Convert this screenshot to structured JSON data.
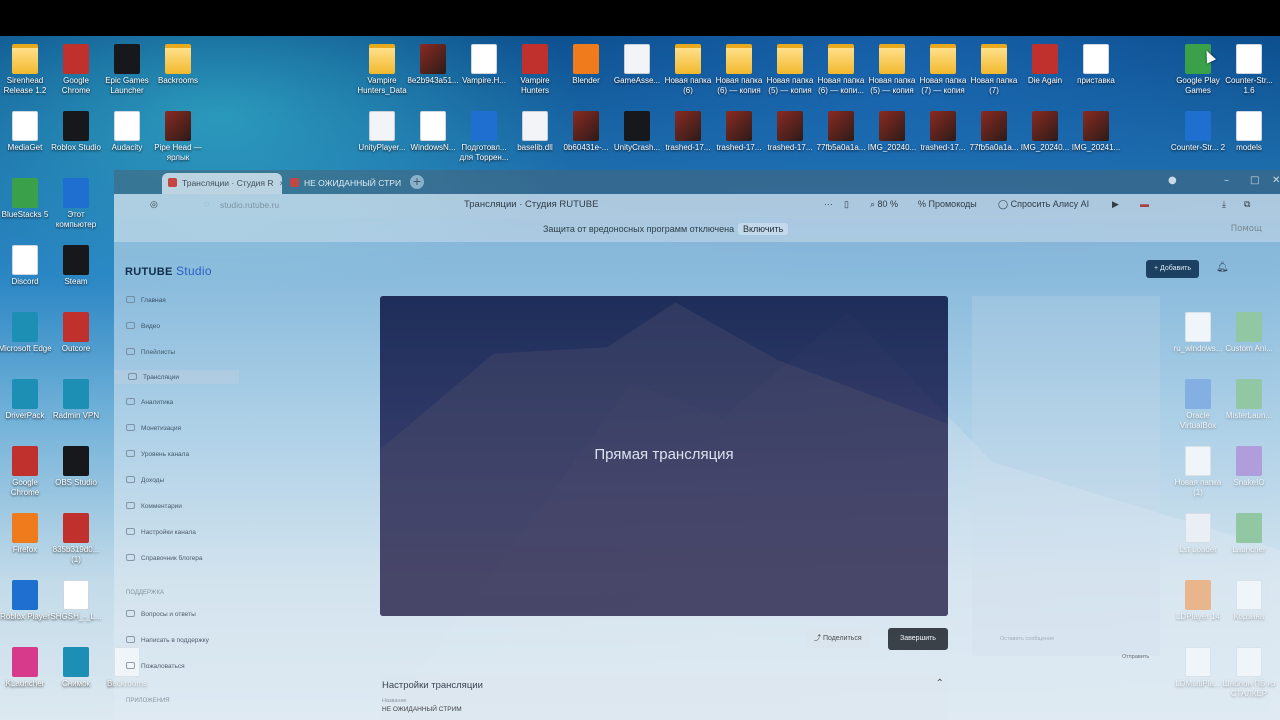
{
  "desktop": {
    "icons": [
      {
        "label": "Sirenhead Release 1.2",
        "kind": "folder"
      },
      {
        "label": "Google Chrome",
        "kind": "chrome"
      },
      {
        "label": "Epic Games Launcher",
        "kind": "epic"
      },
      {
        "label": "Backrooms",
        "kind": "folder"
      },
      {
        "label": "Vampire Hunters_Data",
        "kind": "folder"
      },
      {
        "label": "8e2b943a51...",
        "kind": "photo"
      },
      {
        "label": "Vampire.H...",
        "kind": "doc"
      },
      {
        "label": "Vampire Hunters",
        "kind": "game"
      },
      {
        "label": "Blender",
        "kind": "blender"
      },
      {
        "label": "GameAsse...",
        "kind": "cog"
      },
      {
        "label": "Новая папка (6)",
        "kind": "folder"
      },
      {
        "label": "Новая папка (6) — копия",
        "kind": "folder"
      },
      {
        "label": "Новая папка (5) — копия",
        "kind": "folder"
      },
      {
        "label": "Новая папка (6) — копи...",
        "kind": "folder"
      },
      {
        "label": "Новая папка (5) — копия",
        "kind": "folder"
      },
      {
        "label": "Новая папка (7) — копия",
        "kind": "folder"
      },
      {
        "label": "Новая папка (7)",
        "kind": "folder"
      },
      {
        "label": "Die Again",
        "kind": "game"
      },
      {
        "label": "приставка",
        "kind": "doc"
      },
      {
        "label": "Google Play Games",
        "kind": "gplay"
      },
      {
        "label": "Counter-Str... 1.6",
        "kind": "doc"
      },
      {
        "label": "MediaGet",
        "kind": "doc"
      },
      {
        "label": "Roblox Studio",
        "kind": "roblox"
      },
      {
        "label": "Audacity",
        "kind": "doc"
      },
      {
        "label": "Pipe Head — ярлык",
        "kind": "photo"
      },
      {
        "label": "UnityPlayer...",
        "kind": "cog"
      },
      {
        "label": "WindowsN...",
        "kind": "doc"
      },
      {
        "label": "Подготовл... для Торрен...",
        "kind": "globe"
      },
      {
        "label": "baselib.dll",
        "kind": "cog"
      },
      {
        "label": "0b60431e-...",
        "kind": "photo"
      },
      {
        "label": "UnityCrash...",
        "kind": "unity"
      },
      {
        "label": "trashed-17...",
        "kind": "photo"
      },
      {
        "label": "trashed-17...",
        "kind": "photo"
      },
      {
        "label": "trashed-17...",
        "kind": "photo"
      },
      {
        "label": "77fb5a0a1a...",
        "kind": "photo"
      },
      {
        "label": "IMG_20240...",
        "kind": "photo"
      },
      {
        "label": "trashed-17...",
        "kind": "photo"
      },
      {
        "label": "77fb5a0a1a...",
        "kind": "photo"
      },
      {
        "label": "IMG_20240...",
        "kind": "photo"
      },
      {
        "label": "IMG_20241...",
        "kind": "photo"
      },
      {
        "label": "Counter-Str... 2",
        "kind": "cs"
      },
      {
        "label": "models",
        "kind": "doc"
      },
      {
        "label": "BlueStacks 5",
        "kind": "bluestacks"
      },
      {
        "label": "Этот компьютер",
        "kind": "pc"
      },
      {
        "label": "Discord",
        "kind": "doc"
      },
      {
        "label": "Steam",
        "kind": "steam"
      },
      {
        "label": "Microsoft Edge",
        "kind": "edge"
      },
      {
        "label": "Outcore",
        "kind": "game"
      },
      {
        "label": "DriverPack",
        "kind": "teal"
      },
      {
        "label": "Radmin VPN",
        "kind": "radmin"
      },
      {
        "label": "Google Chrome",
        "kind": "chrome"
      },
      {
        "label": "OBS Studio",
        "kind": "obs"
      },
      {
        "label": "Firefox",
        "kind": "firefox"
      },
      {
        "label": "835b319d0... (1)",
        "kind": "game"
      },
      {
        "label": "Roblox Player",
        "kind": "roblox-player"
      },
      {
        "label": "SHGSH_-_L...",
        "kind": "doc"
      },
      {
        "label": "KLauncher",
        "kind": "klauncher"
      },
      {
        "label": "Снимок",
        "kind": "teal"
      },
      {
        "label": "Backrooms",
        "kind": "doc"
      },
      {
        "label": "LDMultiPla...",
        "kind": "doc"
      },
      {
        "label": "Шаблон ПБ из СТАЛКЕР",
        "kind": "pdf"
      },
      {
        "label": "LDPlayer 14",
        "kind": "ldplayer"
      },
      {
        "label": "Корзина",
        "kind": "bin"
      },
      {
        "label": "Lst Loader",
        "kind": "cog"
      },
      {
        "label": "Launcher",
        "kind": "green"
      },
      {
        "label": "Новая папка (1)",
        "kind": "doc"
      },
      {
        "label": "SnakeIO",
        "kind": "snake"
      },
      {
        "label": "Oracle VirtualBox",
        "kind": "vbox"
      },
      {
        "label": "MisterLaun...",
        "kind": "green"
      },
      {
        "label": "ru_windows...",
        "kind": "doc"
      },
      {
        "label": "Custom Ani...",
        "kind": "android"
      }
    ]
  },
  "browser": {
    "tabs": [
      {
        "label": "Трансляции · Студия R",
        "close": "×"
      },
      {
        "label": "НЕ ОЖИДАННЫЙ СТРИ"
      }
    ],
    "new_tab": "+",
    "address": {
      "url": "studio.rutube.ru",
      "title": "Трансляции · Студия RUTUBE",
      "more": "···",
      "zoom": "80 %",
      "promo": "Промокоды",
      "alice": "Спросить Алису AI"
    },
    "infobar": {
      "message": "Защита от вредоносных программ отключена",
      "enable": "Включить",
      "help": "Помощ"
    }
  },
  "studio": {
    "logo_main": "RUTUBE",
    "logo_sub": "Studio",
    "nav": [
      {
        "label": "Главная",
        "icon": "home-icon"
      },
      {
        "label": "Видео",
        "icon": "video-icon"
      },
      {
        "label": "Плейлисты",
        "icon": "playlist-icon"
      },
      {
        "label": "Трансляции",
        "icon": "broadcast-icon",
        "active": true
      },
      {
        "label": "Аналитика",
        "icon": "analytics-icon"
      },
      {
        "label": "Монетизация",
        "icon": "money-icon"
      },
      {
        "label": "Уровень канала",
        "icon": "star-icon"
      },
      {
        "label": "Доходы",
        "icon": "income-icon"
      },
      {
        "label": "Комментарии",
        "icon": "comments-icon"
      },
      {
        "label": "Настройки канала",
        "icon": "settings-icon"
      },
      {
        "label": "Справочник блогера",
        "icon": "book-icon"
      }
    ],
    "support_title": "ПОДДЕРЖКА",
    "support": [
      {
        "label": "Вопросы и ответы",
        "icon": "faq-icon"
      },
      {
        "label": "Написать в поддержку",
        "icon": "mail-icon"
      },
      {
        "label": "Пожаловаться",
        "icon": "flag-icon"
      }
    ],
    "apps_title": "ПРИЛОЖЕНИЯ",
    "add_button": "+ Добавить",
    "player_caption": "Прямая трансляция",
    "share_button": "Поделиться",
    "finish_button": "Завершить",
    "chat_placeholder": "Оставить сообщение",
    "chat_send": "Отправить",
    "settings_title": "Настройки трансляции",
    "settings_name_label": "Название",
    "settings_name_value": "НЕ ОЖИДАННЫЙ СТРИМ"
  }
}
